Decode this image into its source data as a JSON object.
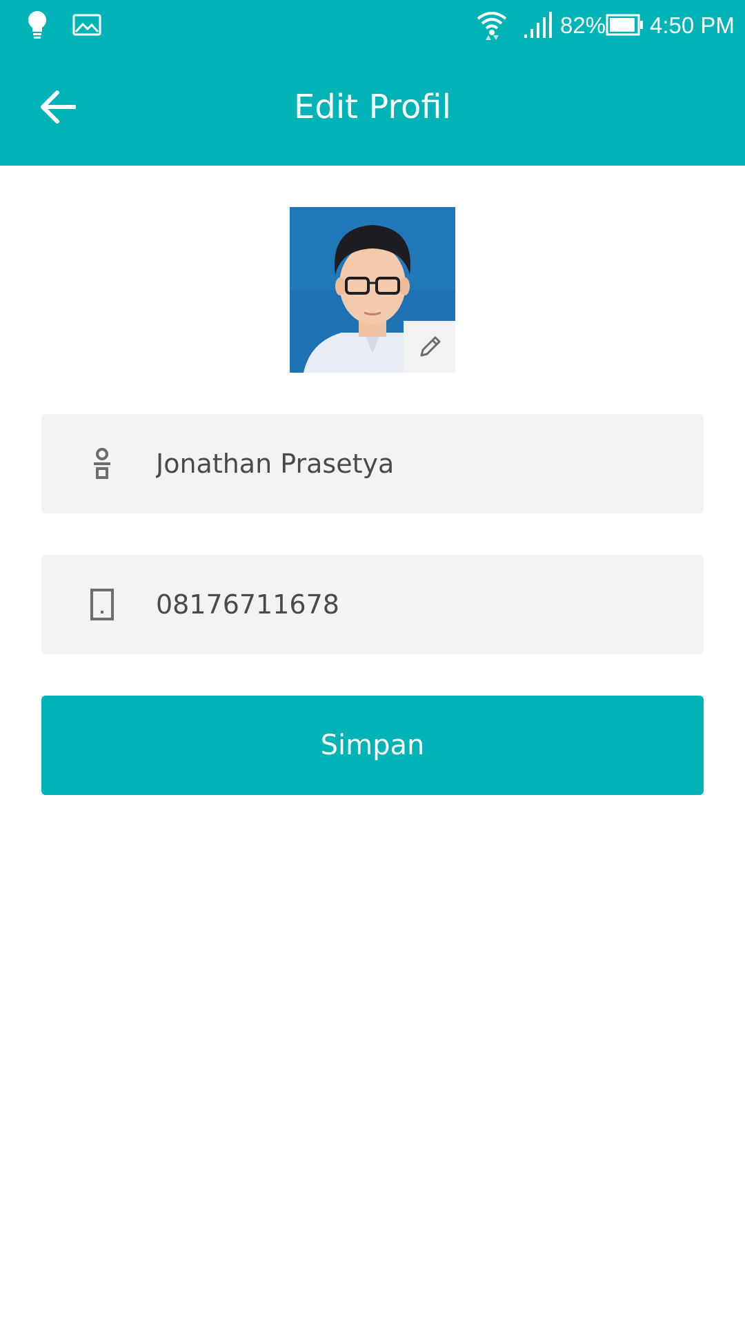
{
  "theme": {
    "accent": "#00b3b7",
    "field_background": "#f3f3f3",
    "text_color": "#4a4a4a"
  },
  "status_bar": {
    "left_icons": [
      "lightbulb-icon",
      "image-icon"
    ],
    "right_icons": [
      "wifi-icon",
      "signal-icon",
      "battery-icon"
    ],
    "battery_percent": "82%",
    "time": "4:50 PM"
  },
  "header": {
    "back_icon": "arrow-left-icon",
    "title": "Edit Profil"
  },
  "profile": {
    "photo": "profile-photo",
    "edit_icon": "pencil-icon"
  },
  "form": {
    "name": {
      "icon": "person-icon",
      "value": "Jonathan Prasetya"
    },
    "phone": {
      "icon": "phone-icon",
      "value": "08176711678"
    },
    "save_label": "Simpan"
  }
}
